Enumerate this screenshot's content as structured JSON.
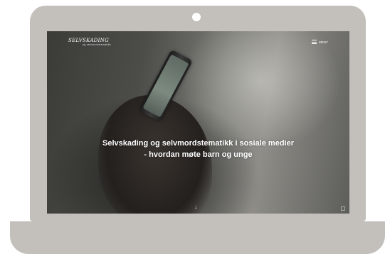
{
  "site": {
    "logo_text": "SELVSKADING",
    "logo_subtext": "og selvmordstematikk"
  },
  "header": {
    "menu_label": "MENY"
  },
  "hero": {
    "headline_line1": "Selvskading og selvmordstematikk i sosiale medier",
    "headline_line2": "- hvordan møte barn og unge",
    "scroll_icon": "arrow-down-icon"
  },
  "colors": {
    "laptop_frame": "#c3c0bb",
    "headline_text": "#ffffff"
  }
}
